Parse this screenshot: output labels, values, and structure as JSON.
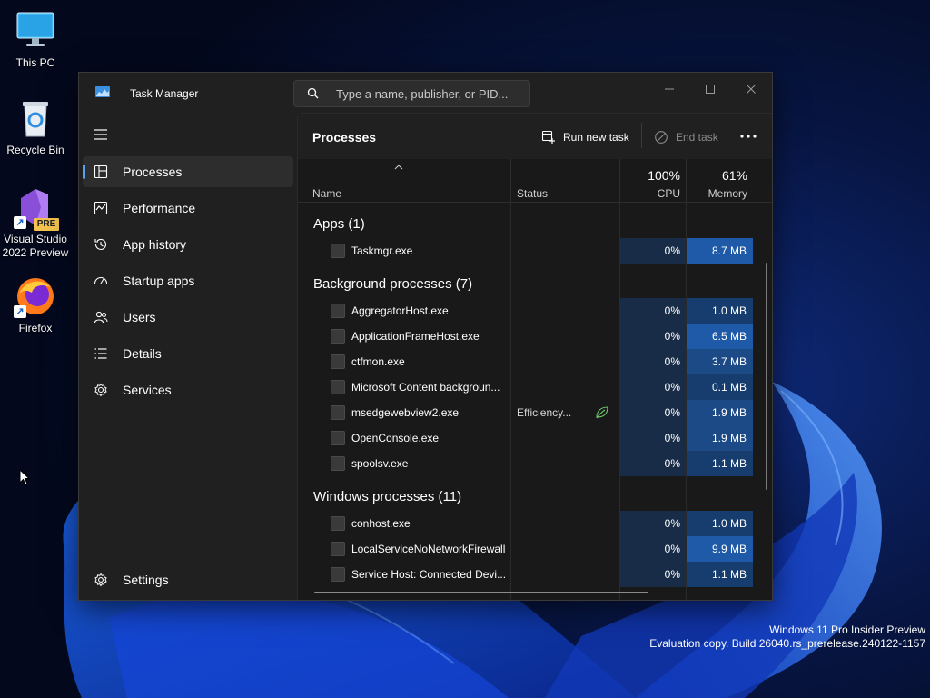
{
  "desktop": {
    "icons": [
      {
        "label_line1": "This PC",
        "label_line2": ""
      },
      {
        "label_line1": "Recycle Bin",
        "label_line2": ""
      },
      {
        "label_line1": "Visual Studio",
        "label_line2": "2022 Preview",
        "badge": "PRE"
      },
      {
        "label_line1": "Firefox",
        "label_line2": ""
      }
    ],
    "watermark": {
      "line1": "Windows 11 Pro Insider Preview",
      "line2": "Evaluation copy. Build 26040.rs_prerelease.240122-1157"
    }
  },
  "window": {
    "title": "Task Manager",
    "search_placeholder": "Type a name, publisher, or PID..."
  },
  "sidebar": {
    "items": [
      {
        "label": "Processes",
        "icon": "processes-icon",
        "active": true
      },
      {
        "label": "Performance",
        "icon": "performance-icon"
      },
      {
        "label": "App history",
        "icon": "app-history-icon"
      },
      {
        "label": "Startup apps",
        "icon": "startup-apps-icon"
      },
      {
        "label": "Users",
        "icon": "users-icon"
      },
      {
        "label": "Details",
        "icon": "details-icon"
      },
      {
        "label": "Services",
        "icon": "services-icon"
      }
    ],
    "settings_label": "Settings"
  },
  "toolbar": {
    "page_title": "Processes",
    "run_new_task": "Run new task",
    "end_task": "End task"
  },
  "columns": {
    "name": "Name",
    "status": "Status",
    "cpu_pct": "100%",
    "cpu": "CPU",
    "memory_pct": "61%",
    "memory": "Memory"
  },
  "groups": [
    {
      "label": "Apps (1)",
      "processes": [
        {
          "name": "Taskmgr.exe",
          "status": "",
          "cpu": "0%",
          "memory": "8.7 MB",
          "mem_level": 3
        }
      ]
    },
    {
      "label": "Background processes (7)",
      "processes": [
        {
          "name": "AggregatorHost.exe",
          "status": "",
          "cpu": "0%",
          "memory": "1.0 MB",
          "mem_level": 1
        },
        {
          "name": "ApplicationFrameHost.exe",
          "status": "",
          "cpu": "0%",
          "memory": "6.5 MB",
          "mem_level": 3
        },
        {
          "name": "ctfmon.exe",
          "status": "",
          "cpu": "0%",
          "memory": "3.7 MB",
          "mem_level": 2
        },
        {
          "name": "Microsoft Content backgroun...",
          "status": "",
          "cpu": "0%",
          "memory": "0.1 MB",
          "mem_level": 1
        },
        {
          "name": "msedgewebview2.exe",
          "status": "Efficiency...",
          "cpu": "0%",
          "memory": "1.9 MB",
          "mem_level": 2
        },
        {
          "name": "OpenConsole.exe",
          "status": "",
          "cpu": "0%",
          "memory": "1.9 MB",
          "mem_level": 2
        },
        {
          "name": "spoolsv.exe",
          "status": "",
          "cpu": "0%",
          "memory": "1.1 MB",
          "mem_level": 1
        }
      ]
    },
    {
      "label": "Windows processes (11)",
      "processes": [
        {
          "name": "conhost.exe",
          "status": "",
          "cpu": "0%",
          "memory": "1.0 MB",
          "mem_level": 1
        },
        {
          "name": "LocalServiceNoNetworkFirewall",
          "status": "",
          "cpu": "0%",
          "memory": "9.9 MB",
          "mem_level": 3
        },
        {
          "name": "Service Host: Connected Devi...",
          "status": "",
          "cpu": "0%",
          "memory": "1.1 MB",
          "mem_level": 1
        }
      ]
    }
  ],
  "colors": {
    "accent": "#5aa0f0",
    "mem_levels": [
      "#173d6e",
      "#1c4a86",
      "#1f5aa8"
    ]
  }
}
